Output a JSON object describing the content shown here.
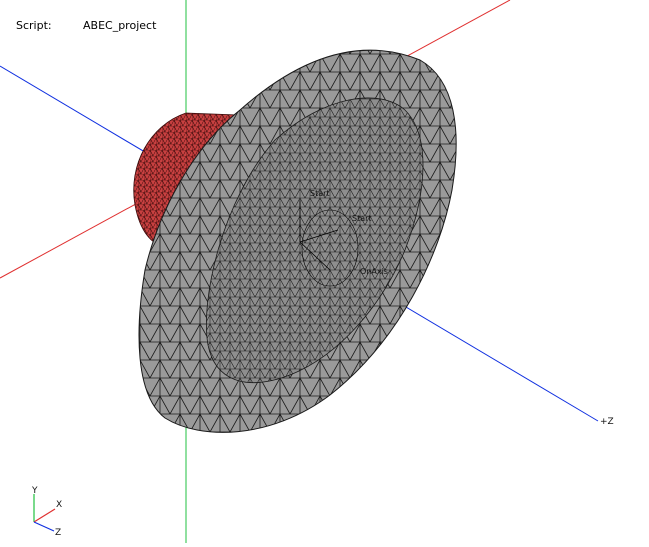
{
  "script": {
    "label": "Script:",
    "value": "ABEC_project"
  },
  "scene": {
    "axis_plus_z": "+Z",
    "labels": {
      "start_a": "Start",
      "start_b": "Start",
      "onaxis": "OnAxis"
    }
  },
  "triad": {
    "x": "X",
    "y": "Y",
    "z": "Z"
  },
  "colors": {
    "background": "#ffffff",
    "mesh_fill": "#9a9a9a",
    "mesh_inner": "#8a8a8a",
    "mesh_edges": "#1a1a1a",
    "driver_fill": "#c84040",
    "driver_edges": "#3a0a0a",
    "axis_x": "#e03030",
    "axis_y": "#20c040",
    "axis_z": "#1030e0",
    "triad_x": "#e03030",
    "triad_y": "#20c040",
    "triad_z": "#1030e0"
  }
}
